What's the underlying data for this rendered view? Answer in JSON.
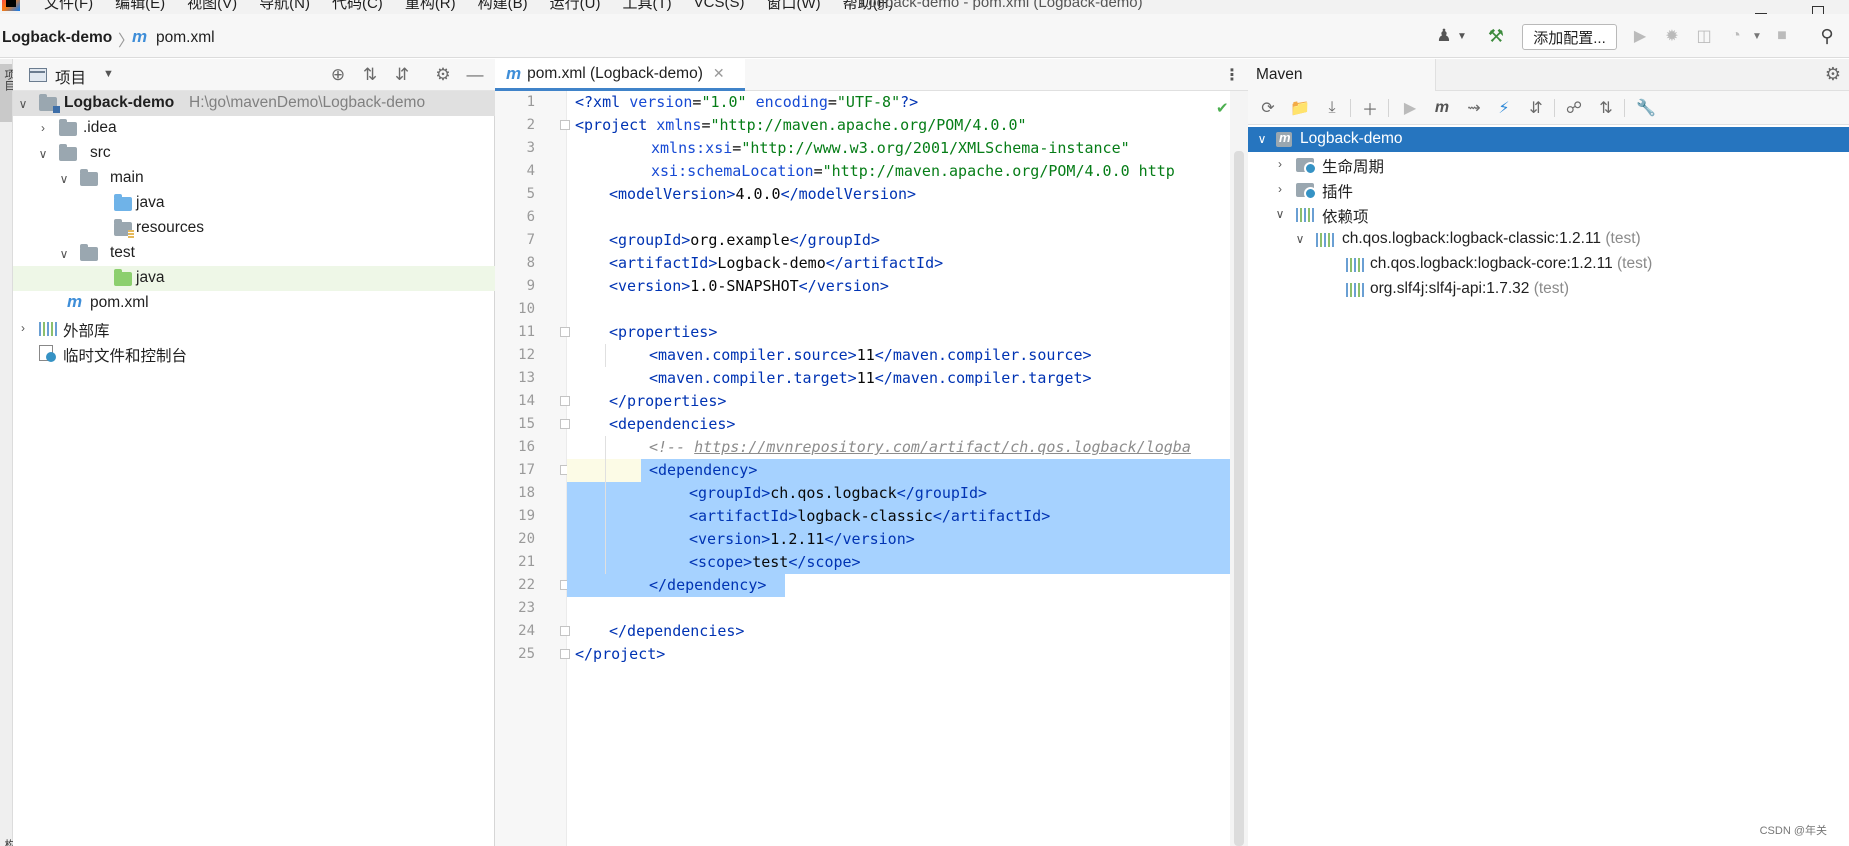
{
  "window": {
    "title": "Logback-demo - pom.xml (Logback-demo)"
  },
  "menu": [
    "文件(F)",
    "编辑(E)",
    "视图(V)",
    "导航(N)",
    "代码(C)",
    "重构(R)",
    "构建(B)",
    "运行(U)",
    "工具(T)",
    "VCS(S)",
    "窗口(W)",
    "帮助(H)"
  ],
  "navbar": {
    "project": "Logback-demo",
    "file": "pom.xml",
    "add_config_label": "添加配置..."
  },
  "left_strip": {
    "top_label": "项目",
    "bottom_label": "结构"
  },
  "project_panel": {
    "title": "项目",
    "tree": [
      {
        "label": "Logback-demo",
        "path": "H:\\go\\mavenDemo\\Logback-demo"
      },
      {
        "label": ".idea"
      },
      {
        "label": "src"
      },
      {
        "label": "main"
      },
      {
        "label": "java"
      },
      {
        "label": "resources"
      },
      {
        "label": "test"
      },
      {
        "label": "java"
      },
      {
        "label": "pom.xml"
      },
      {
        "label": "外部库"
      },
      {
        "label": "临时文件和控制台"
      }
    ]
  },
  "editor": {
    "tab_label": "pom.xml (Logback-demo)",
    "line_numbers": [
      "1",
      "2",
      "3",
      "4",
      "5",
      "6",
      "7",
      "8",
      "9",
      "10",
      "11",
      "12",
      "13",
      "14",
      "15",
      "16",
      "17",
      "18",
      "19",
      "20",
      "21",
      "22",
      "23",
      "24",
      "25"
    ],
    "code": {
      "l1_a": "<?xml ",
      "l1_b": "version",
      "l1_c": "=",
      "l1_d": "\"1.0\"",
      "l1_e": " encoding",
      "l1_f": "=",
      "l1_g": "\"UTF-8\"",
      "l1_h": "?>",
      "l2_a": "<project ",
      "l2_b": "xmlns",
      "l2_c": "=",
      "l2_d": "\"http://maven.apache.org/POM/4.0.0\"",
      "l3_a": "xmlns:xsi",
      "l3_b": "=",
      "l3_c": "\"http://www.w3.org/2001/XMLSchema-instance\"",
      "l4_a": "xsi:schemaLocation",
      "l4_b": "=",
      "l4_c": "\"http://maven.apache.org/POM/4.0.0 http",
      "l5_a": "<modelVersion>",
      "l5_b": "4.0.0",
      "l5_c": "</modelVersion>",
      "l7_a": "<groupId>",
      "l7_b": "org.example",
      "l7_c": "</groupId>",
      "l8_a": "<artifactId>",
      "l8_b": "Logback-demo",
      "l8_c": "</artifactId>",
      "l9_a": "<version>",
      "l9_b": "1.0-SNAPSHOT",
      "l9_c": "</version>",
      "l11": "<properties>",
      "l12_a": "<maven.compiler.source>",
      "l12_b": "11",
      "l12_c": "</maven.compiler.source>",
      "l13_a": "<maven.compiler.target>",
      "l13_b": "11",
      "l13_c": "</maven.compiler.target>",
      "l14": "</properties>",
      "l15": "<dependencies>",
      "l16_a": "<!-- ",
      "l16_b": "https://mvnrepository.com/artifact/ch.qos.logback/logba",
      "l17": "<dependency>",
      "l18_a": "<groupId>",
      "l18_b": "ch.qos.logback",
      "l18_c": "</groupId>",
      "l19_a": "<artifactId>",
      "l19_b": "logback-classic",
      "l19_c": "</artifactId>",
      "l20_a": "<version>",
      "l20_b": "1.2.11",
      "l20_c": "</version>",
      "l21_a": "<scope>",
      "l21_b": "test",
      "l21_c": "</scope>",
      "l22": "</dependency>",
      "l24": "</dependencies>",
      "l25": "</project>"
    }
  },
  "maven": {
    "title": "Maven",
    "tree": [
      {
        "label": "Logback-demo"
      },
      {
        "label": "生命周期"
      },
      {
        "label": "插件"
      },
      {
        "label": "依赖项"
      },
      {
        "label": "ch.qos.logback:logback-classic:1.2.11",
        "scope": "(test)"
      },
      {
        "label": "ch.qos.logback:logback-core:1.2.11",
        "scope": "(test)"
      },
      {
        "label": "org.slf4j:slf4j-api:1.7.32",
        "scope": "(test)"
      }
    ]
  },
  "watermark": "CSDN @年关",
  "colors": {
    "selection": "#a6d2ff",
    "maven_selected": "#2675bf",
    "xml_tag": "#0033b3",
    "xml_attr_value": "#067d17"
  }
}
